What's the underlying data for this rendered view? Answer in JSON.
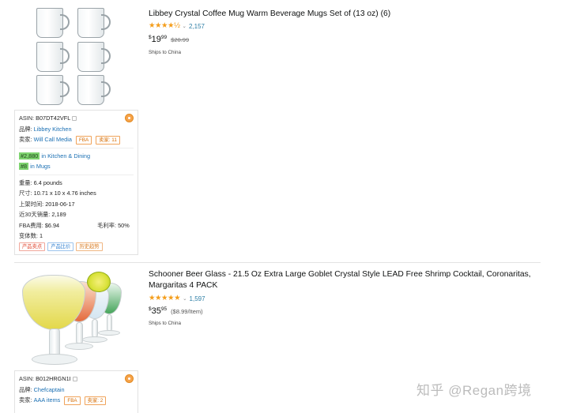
{
  "products": [
    {
      "title": "Libbey Crystal Coffee Mug Warm Beverage Mugs Set of (13 oz) (6)",
      "stars": "★★★★½",
      "rating_count": "2,157",
      "price_symbol": "$",
      "price_whole": "19",
      "price_fraction": "99",
      "list_price": "$20.99",
      "unit_price": "",
      "ships": "Ships to China",
      "asin_label": "ASIN:",
      "asin": "B07DT42VFL",
      "brand_label": "品牌:",
      "brand": "Libbey Kitchen",
      "seller_label": "卖家:",
      "seller": "Will Call Media",
      "fba_tag": "FBA",
      "sellers_tag": "卖家: 11",
      "rank1": "#2,880",
      "rank1_cat": "in Kitchen & Dining",
      "rank2": "#8",
      "rank2_cat": "in Mugs",
      "weight_label": "重量:",
      "weight": "6.4 pounds",
      "size_label": "尺寸:",
      "size": "10.71 x 10 x 4.76 inches",
      "listed_label": "上架时间:",
      "listed": "2018-06-17",
      "sales_label": "近30天销量:",
      "sales": "2,189",
      "fba_fee_label": "FBA费用:",
      "fba_fee": "$6.94",
      "margin_label": "毛利率:",
      "margin": "50%",
      "variants_label": "变体数:",
      "variants": "1",
      "btn_highlights": "产品卖点",
      "btn_compare": "产品比价",
      "btn_history": "历史趋势"
    },
    {
      "title": "Schooner Beer Glass - 21.5 Oz Extra Large Goblet Crystal Style LEAD Free Shrimp Cocktail, Coronaritas, Margaritas 4 PACK",
      "stars": "★★★★★",
      "rating_count": "1,597",
      "price_symbol": "$",
      "price_whole": "35",
      "price_fraction": "95",
      "list_price": "",
      "unit_price": "($8.99/Item)",
      "ships": "Ships to China",
      "asin_label": "ASIN:",
      "asin": "B012HRGN1I",
      "brand_label": "品牌:",
      "brand": "Chefcaptain",
      "seller_label": "卖家:",
      "seller": "AAA items",
      "fba_tag": "FBA",
      "sellers_tag": "卖家: 2"
    }
  ],
  "watermark": "知乎 @Regan跨境",
  "colors": {
    "star": "#f49d1a",
    "link": "#1a6fb3",
    "rank_highlight": "#7ed36f",
    "tag_orange": "#d66b00"
  },
  "icons": [
    "coin-icon",
    "copy-icon",
    "chevron-down-icon"
  ]
}
